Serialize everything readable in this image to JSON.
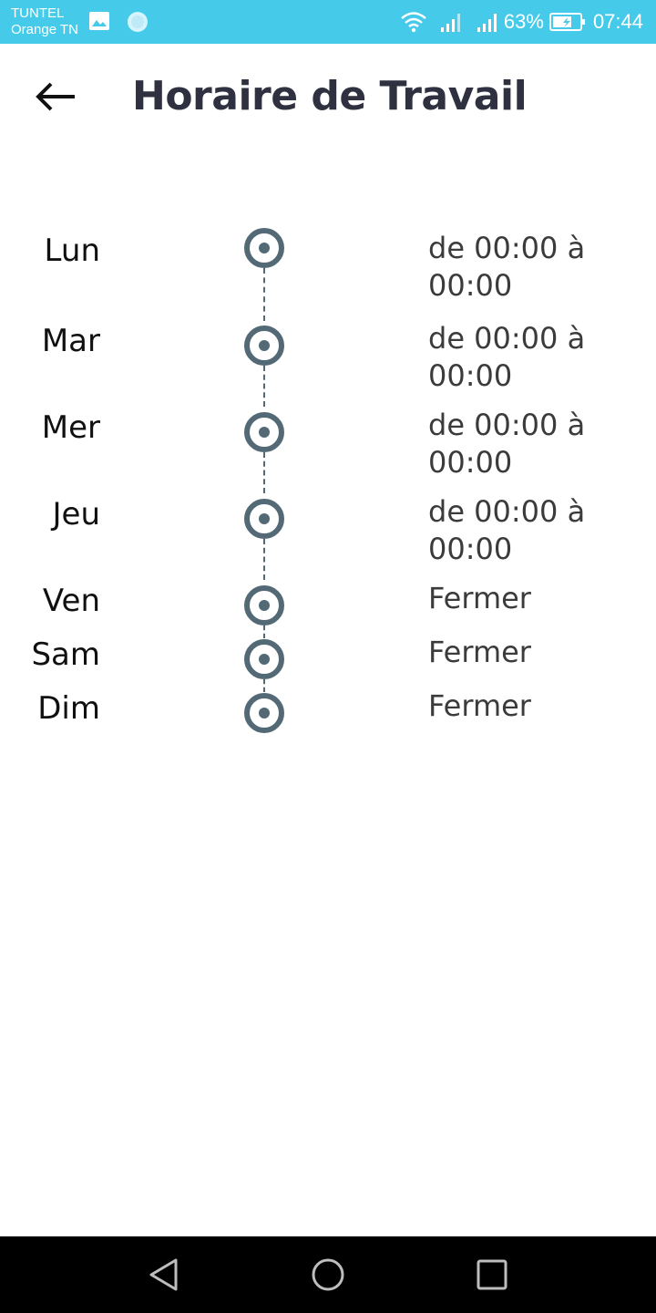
{
  "status_bar": {
    "carrier_line1": "TUNTEL",
    "carrier_line2": "Orange TN",
    "battery_percent": "63%",
    "time": "07:44",
    "color": "#45cbe9",
    "icons": [
      "gallery-icon",
      "circle-icon",
      "wifi-icon",
      "signal-icon",
      "signal-icon",
      "battery-charging-icon"
    ]
  },
  "header": {
    "title": "Horaire de Travail",
    "back_icon": "arrow-left-icon"
  },
  "schedule": [
    {
      "day": "Lun",
      "hours": "de 00:00 à 00:00"
    },
    {
      "day": "Mar",
      "hours": "de 00:00 à 00:00"
    },
    {
      "day": "Mer",
      "hours": "de 00:00 à 00:00"
    },
    {
      "day": "Jeu",
      "hours": "de 00:00 à 00:00"
    },
    {
      "day": "Ven",
      "hours": "Fermer"
    },
    {
      "day": "Sam",
      "hours": "Fermer"
    },
    {
      "day": "Dim",
      "hours": "Fermer"
    }
  ],
  "colors": {
    "accent": "#536a76",
    "title": "#2f3040"
  },
  "nav_bar": {
    "icons": [
      "nav-back-icon",
      "nav-home-icon",
      "nav-recent-icon"
    ]
  }
}
